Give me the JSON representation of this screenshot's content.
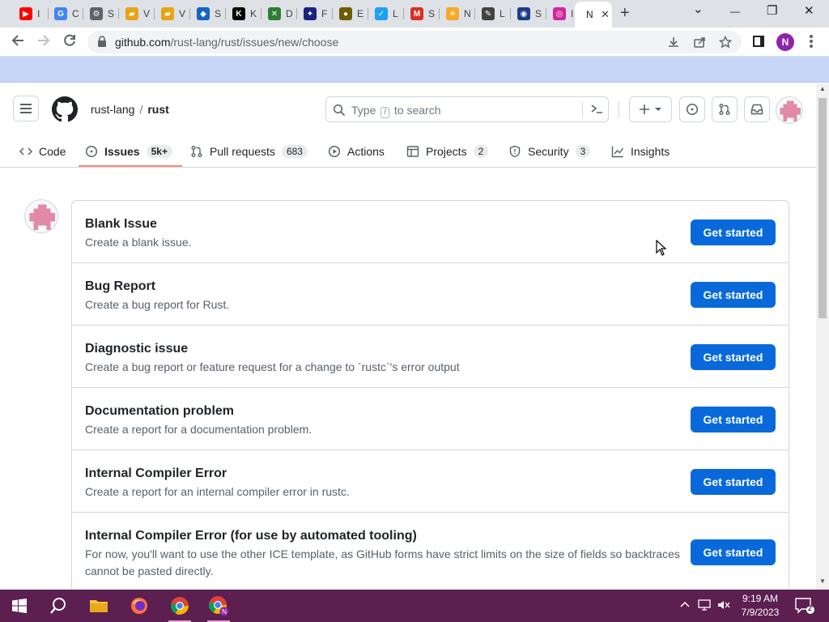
{
  "browser": {
    "tabs": [
      {
        "label": "I",
        "favicon": "youtube-icon",
        "color": "#ff0000",
        "glyph": "▶"
      },
      {
        "label": "C",
        "favicon": "google-icon",
        "color": "#4285f4",
        "glyph": "G"
      },
      {
        "label": "S",
        "favicon": "settings-icon",
        "color": "#5f6368",
        "glyph": "⚙"
      },
      {
        "label": "V",
        "favicon": "folder-icon",
        "color": "#e8a317",
        "glyph": "▰"
      },
      {
        "label": "V",
        "favicon": "folder-icon",
        "color": "#e8a317",
        "glyph": "▰"
      },
      {
        "label": "S",
        "favicon": "image-icon",
        "color": "#1565c0",
        "glyph": "◆"
      },
      {
        "label": "K",
        "favicon": "kim-icon",
        "color": "#000000",
        "glyph": "K"
      },
      {
        "label": "D",
        "favicon": "cross-icon",
        "color": "#2e7d32",
        "glyph": "✕"
      },
      {
        "label": "F",
        "favicon": "globe-icon",
        "color": "#1a237e",
        "glyph": "✦"
      },
      {
        "label": "E",
        "favicon": "dot-icon",
        "color": "#6b5d00",
        "glyph": "●"
      },
      {
        "label": "L",
        "favicon": "twitter-icon",
        "color": "#1da1f2",
        "glyph": "✓"
      },
      {
        "label": "S",
        "favicon": "gmail-icon",
        "color": "#d93025",
        "glyph": "M"
      },
      {
        "label": "N",
        "favicon": "bulb-icon",
        "color": "#f9a825",
        "glyph": "☀"
      },
      {
        "label": "L",
        "favicon": "sketch-icon",
        "color": "#424242",
        "glyph": "✎"
      },
      {
        "label": "S",
        "favicon": "sonic-icon",
        "color": "#1e3a8a",
        "glyph": "◉"
      },
      {
        "label": "I",
        "favicon": "instagram-icon",
        "color": "#d6249f",
        "glyph": "◎"
      }
    ],
    "active_tab_label": "N",
    "new_tab_symbol": "+",
    "window_controls": {
      "chevron": "⌄",
      "minimize": "—",
      "restore": "❐",
      "close": "✕"
    },
    "url_host": "github.com",
    "url_path": "/rust-lang/rust/issues/new/choose",
    "profile_initial": "N"
  },
  "github": {
    "owner": "rust-lang",
    "separator": "/",
    "repo": "rust",
    "search_prefix": "Type",
    "search_key": "/",
    "search_suffix": "to search",
    "command_symbol": ">_",
    "nav": [
      {
        "label": "Code",
        "count": "",
        "icon": "code-icon"
      },
      {
        "label": "Issues",
        "count": "5k+",
        "icon": "issue-opened-icon"
      },
      {
        "label": "Pull requests",
        "count": "683",
        "icon": "git-pull-request-icon"
      },
      {
        "label": "Actions",
        "count": "",
        "icon": "play-icon"
      },
      {
        "label": "Projects",
        "count": "2",
        "icon": "table-icon"
      },
      {
        "label": "Security",
        "count": "3",
        "icon": "shield-icon"
      },
      {
        "label": "Insights",
        "count": "",
        "icon": "graph-icon"
      }
    ],
    "selected_nav": "Issues",
    "accent": "#0969da",
    "underline": "#fd8c73"
  },
  "templates": [
    {
      "name": "Blank Issue",
      "description": "Create a blank issue.",
      "button": "Get started"
    },
    {
      "name": "Bug Report",
      "description": "Create a bug report for Rust.",
      "button": "Get started"
    },
    {
      "name": "Diagnostic issue",
      "description": "Create a bug report or feature request for a change to `rustc`'s error output",
      "button": "Get started"
    },
    {
      "name": "Documentation problem",
      "description": "Create a report for a documentation problem.",
      "button": "Get started"
    },
    {
      "name": "Internal Compiler Error",
      "description": "Create a report for an internal compiler error in rustc.",
      "button": "Get started"
    },
    {
      "name": "Internal Compiler Error (for use by automated tooling)",
      "description": "For now, you'll want to use the other ICE template, as GitHub forms have strict limits on the size of fields so backtraces cannot be pasted directly.",
      "button": "Get started"
    }
  ],
  "taskbar": {
    "time": "9:19 AM",
    "date": "7/9/2023",
    "notification_count": "2",
    "apps": [
      "windows-start-icon",
      "search-icon",
      "file-explorer-icon",
      "firefox-icon",
      "chrome-icon",
      "chrome-profile-icon"
    ]
  }
}
